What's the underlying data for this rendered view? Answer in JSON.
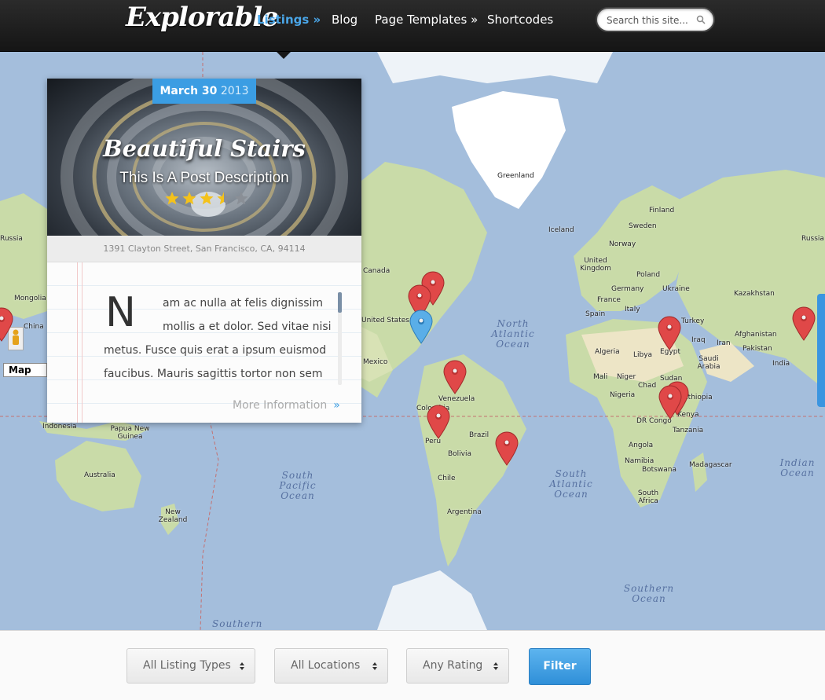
{
  "header": {
    "logo": "Explorable",
    "nav": [
      {
        "label": "Listings »",
        "active": true
      },
      {
        "label": "Blog",
        "active": false
      },
      {
        "label": "Page Templates »",
        "active": false
      },
      {
        "label": "Shortcodes",
        "active": false
      }
    ],
    "search": {
      "placeholder": "Search this site..."
    }
  },
  "map": {
    "map_type_label": "Map",
    "labels": {
      "greenland": "Greenland",
      "iceland": "Iceland",
      "finland": "Finland",
      "sweden": "Sweden",
      "norway": "Norway",
      "united_kingdom": "United Kingdom",
      "poland": "Poland",
      "germany": "Germany",
      "ukraine": "Ukraine",
      "france": "France",
      "spain": "Spain",
      "italy": "Italy",
      "kazakhstan": "Kazakhstan",
      "russia_left": "Russia",
      "russia_right": "Russia",
      "mongolia": "Mongolia",
      "china": "China",
      "turkey": "Turkey",
      "afghanistan": "Afghanistan",
      "iraq": "Iraq",
      "iran": "Iran",
      "pakistan": "Pakistan",
      "india": "India",
      "algeria": "Algeria",
      "libya": "Libya",
      "egypt": "Egypt",
      "saudi_arabia": "Saudi Arabia",
      "mali": "Mali",
      "niger": "Niger",
      "chad": "Chad",
      "sudan": "Sudan",
      "ethiopia": "Ethiopia",
      "nigeria": "Nigeria",
      "kenya": "Kenya",
      "dr_congo": "DR Congo",
      "tanzania": "Tanzania",
      "angola": "Angola",
      "namibia": "Namibia",
      "botswana": "Botswana",
      "madagascar": "Madagascar",
      "south_africa": "South Africa",
      "canada": "Canada",
      "united_states": "United States",
      "mexico": "Mexico",
      "venezuela": "Venezuela",
      "colombia": "Colombia",
      "brazil": "Brazil",
      "peru": "Peru",
      "bolivia": "Bolivia",
      "chile": "Chile",
      "argentina": "Argentina",
      "indonesia": "Indonesia",
      "papua_new_guinea": "Papua New Guinea",
      "australia": "Australia",
      "new_zealand": "New Zealand"
    },
    "oceans": {
      "north_atlantic": "North Atlantic Ocean",
      "south_atlantic": "South Atlantic Ocean",
      "south_pacific": "South Pacific Ocean",
      "indian": "Indian Ocean",
      "southern": "Southern Ocean",
      "southern_bottom": "Southern"
    },
    "colors": {
      "water": "#a4bedc",
      "land": "#c9dba8",
      "desert": "#ede5c6",
      "ice": "#ffffff",
      "pin_red": "#e04848",
      "pin_blue": "#5aaee8"
    }
  },
  "listing": {
    "date": {
      "month_day": "March 30",
      "year": "2013"
    },
    "title": "Beautiful Stairs",
    "description": "This Is A Post Description",
    "rating": 3.5,
    "rating_max": 5,
    "address": "1391 Clayton Street, San Francisco, CA, 94114",
    "excerpt": {
      "drop_cap": "N",
      "lines": [
        "am ac nulla at felis dignissim",
        "mollis a et dolor. Sed vitae nisi",
        "metus. Fusce quis erat a ipsum euismod",
        "faucibus. Mauris sagittis tortor non sem"
      ]
    },
    "more_label": "More Information",
    "more_arrow": "»"
  },
  "filters": {
    "listing_type": "All Listing Types",
    "location": "All Locations",
    "rating": "Any Rating",
    "button": "Filter"
  }
}
